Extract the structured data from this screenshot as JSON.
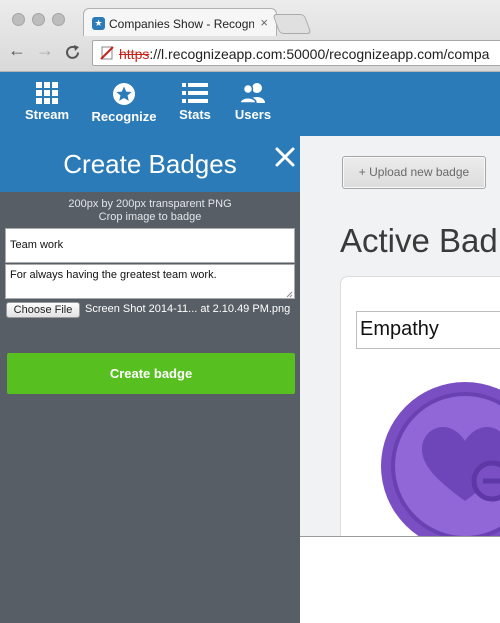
{
  "browser": {
    "tab_title": "Companies Show - Recognize",
    "tab_close": "×",
    "url_scheme": "https",
    "url_rest": "://l.recognizeapp.com:50000/recognizeapp.com/compa",
    "back_glyph": "←",
    "forward_glyph": "→",
    "reload_glyph": "C",
    "favicon": "star-icon"
  },
  "nav": {
    "items": [
      {
        "label": "Stream",
        "icon": "grid-icon"
      },
      {
        "label": "Recognize",
        "icon": "star-badge-icon"
      },
      {
        "label": "Stats",
        "icon": "list-icon"
      },
      {
        "label": "Users",
        "icon": "users-icon"
      }
    ]
  },
  "panel": {
    "title": "Create Badges",
    "close_icon": "close-icon",
    "hint_line1": "200px by 200px transparent PNG",
    "hint_line2": "Crop image to badge",
    "name_value": "Team work",
    "description_value": "For always having the greatest team work.",
    "choose_file_label": "Choose File",
    "file_name": "Screen Shot 2014-11... at 2.10.49 PM.png",
    "create_button_label": "Create badge"
  },
  "main": {
    "upload_button_label": "+ Upload new badge",
    "heading": "Active Bad",
    "badges": [
      {
        "name": "Empathy",
        "icon": "heart-icon"
      }
    ]
  },
  "colors": {
    "brand_blue": "#2a7bb7",
    "panel_gray": "#575e66",
    "create_green": "#57bf1f",
    "badge_purple": "#7b4fc4"
  }
}
